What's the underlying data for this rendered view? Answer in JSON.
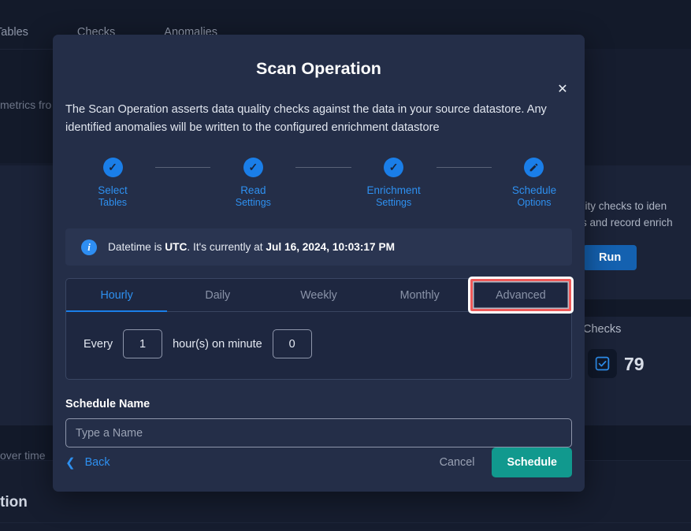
{
  "background": {
    "tabs": [
      {
        "label": "Tables"
      },
      {
        "label": "Checks"
      },
      {
        "label": "Anomalies"
      }
    ],
    "left_text": "metrics fro",
    "right_desc_line1": "quality checks to iden",
    "right_desc_line2": "alies and record enrich",
    "run_button": "Run",
    "checks_label": "Checks",
    "checks_count": "79",
    "over_time_text": "over time",
    "bottom_title": "tion"
  },
  "modal": {
    "close_icon": "close-icon",
    "title": "Scan Operation",
    "description": "The Scan Operation asserts data quality checks against the data in your source datastore. Any identified anomalies will be written to the configured enrichment datastore",
    "stepper": [
      {
        "label": "Select",
        "sub": "Tables",
        "icon": "check-icon"
      },
      {
        "label": "Read",
        "sub": "Settings",
        "icon": "check-icon"
      },
      {
        "label": "Enrichment",
        "sub": "Settings",
        "icon": "check-icon"
      },
      {
        "label": "Schedule",
        "sub": "Options",
        "icon": "pencil-icon"
      }
    ],
    "info": {
      "icon": "info-icon",
      "prefix": "Datetime is ",
      "timezone": "UTC",
      "middle": ". It's currently at ",
      "datetime": "Jul 16, 2024, 10:03:17 PM"
    },
    "tabs": [
      {
        "label": "Hourly",
        "active": true,
        "highlighted": false
      },
      {
        "label": "Daily",
        "active": false,
        "highlighted": false
      },
      {
        "label": "Weekly",
        "active": false,
        "highlighted": false
      },
      {
        "label": "Monthly",
        "active": false,
        "highlighted": false
      },
      {
        "label": "Advanced",
        "active": false,
        "highlighted": true
      }
    ],
    "hourly_panel": {
      "every_label": "Every",
      "hours_value": "1",
      "middle_label": "hour(s) on minute",
      "minute_value": "0"
    },
    "schedule_name": {
      "label": "Schedule Name",
      "placeholder": "Type a Name",
      "value": ""
    },
    "footer": {
      "back_label": "Back",
      "back_icon": "chevron-left-icon",
      "cancel_label": "Cancel",
      "schedule_label": "Schedule"
    }
  },
  "colors": {
    "accent_blue": "#1a7ee8",
    "link_blue": "#2e90f0",
    "teal": "#11998e",
    "highlight_red": "#ef5a5a",
    "modal_bg": "#242e48",
    "page_bg": "#151c2e"
  }
}
